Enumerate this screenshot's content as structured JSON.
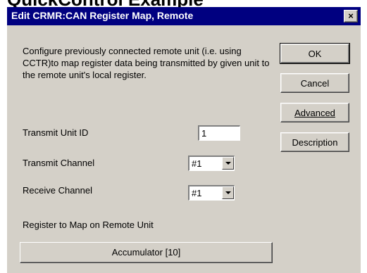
{
  "heading": "QuickControl Example",
  "dialog": {
    "title": "Edit CRMR:CAN Register Map, Remote",
    "close_label": "×",
    "description": "Configure previously connected remote unit (i.e. using CCTR)to map register data being transmitted by given unit to the remote unit's local register.",
    "buttons": {
      "ok": "OK",
      "cancel": "Cancel",
      "advanced": "Advanced",
      "description": "Description"
    },
    "transmit_unit_id": {
      "label": "Transmit Unit ID",
      "value": "1"
    },
    "transmit_channel": {
      "label": "Transmit Channel",
      "value": "#1"
    },
    "receive_channel": {
      "label": "Receive Channel",
      "value": "#1"
    },
    "register_map": {
      "label": "Register to Map on Remote Unit",
      "value": "Accumulator [10]"
    }
  },
  "colors": {
    "titlebar": "#000080",
    "face": "#d4d0c8"
  }
}
